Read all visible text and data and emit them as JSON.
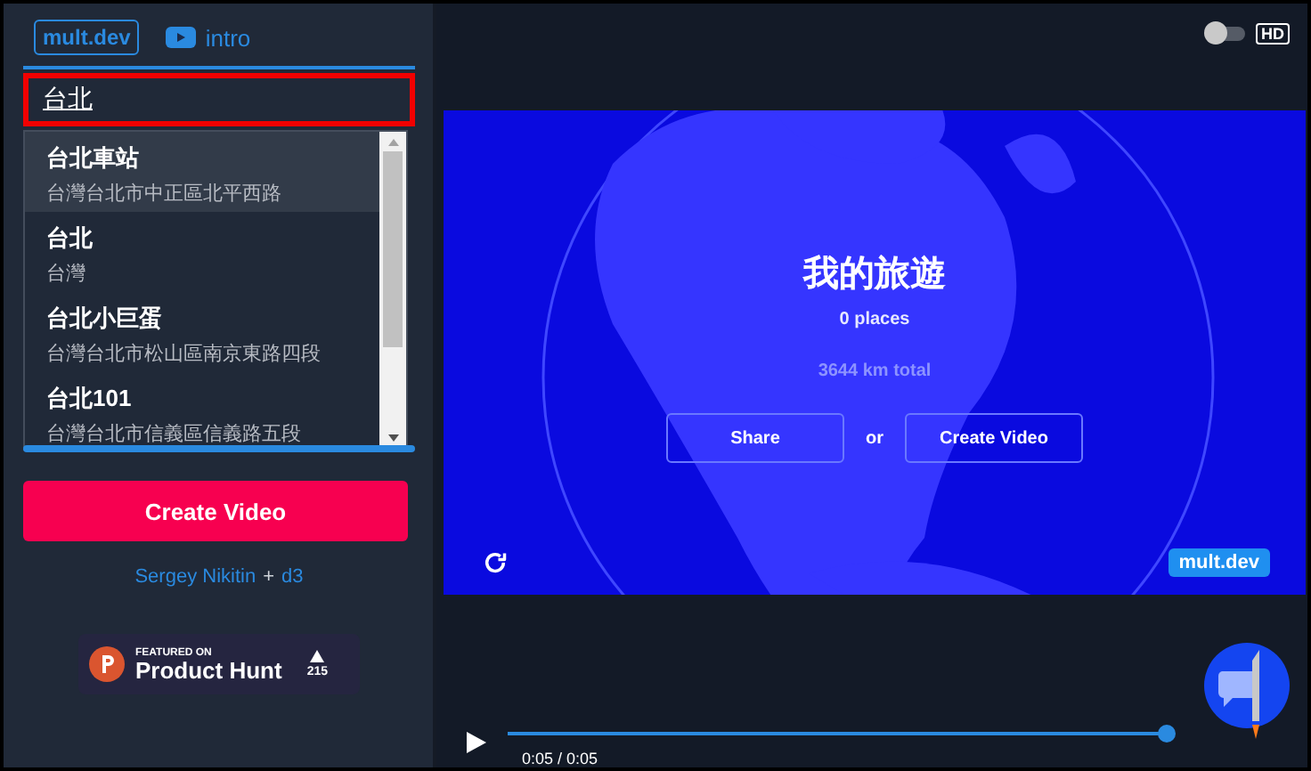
{
  "header": {
    "logo": "mult.dev",
    "intro_link": "intro"
  },
  "search": {
    "value": "台北"
  },
  "suggestions": [
    {
      "name": "台北車站",
      "address": "台灣台北市中正區北平西路",
      "selected": true
    },
    {
      "name": "台北",
      "address": "台灣",
      "selected": false
    },
    {
      "name": "台北小巨蛋",
      "address": "台灣台北市松山區南京東路四段",
      "selected": false
    },
    {
      "name": "台北101",
      "address": "台灣台北市信義區信義路五段",
      "selected": false
    }
  ],
  "create_button": "Create Video",
  "credits": {
    "author": "Sergey Nikitin",
    "plus": "+",
    "library": "d3"
  },
  "product_hunt": {
    "featured": "FEATURED ON",
    "name": "Product Hunt",
    "votes": "215"
  },
  "hd_toggle": {
    "on": false,
    "label": "HD"
  },
  "preview": {
    "title": "我的旅遊",
    "places": "0 places",
    "distance": "3644 km total",
    "share_button": "Share",
    "or": "or",
    "create_button": "Create Video",
    "badge": "mult.dev"
  },
  "player": {
    "level": 1,
    "time": "0:05 / 0:05"
  }
}
